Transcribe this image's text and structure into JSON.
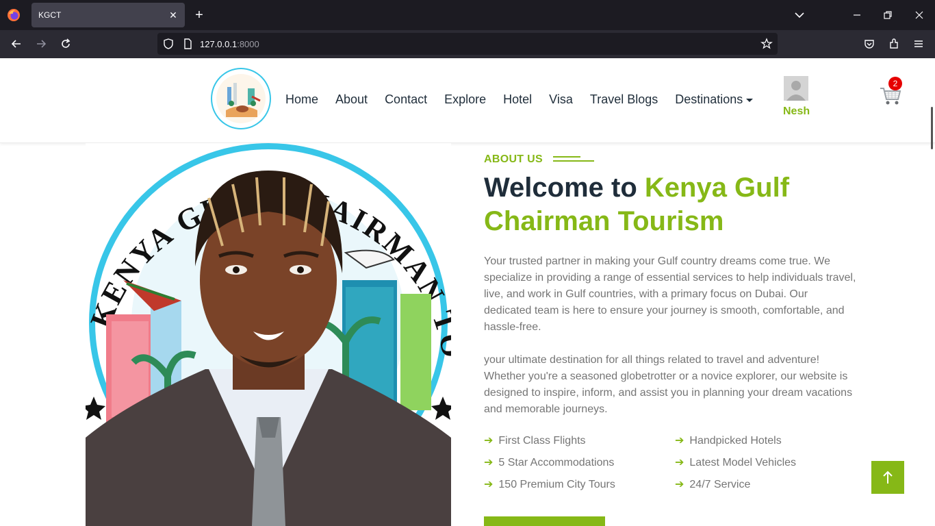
{
  "browser": {
    "tab_title": "KGCT",
    "tab_close": "✕",
    "new_tab": "+",
    "url_host": "127.0.0.1",
    "url_port": ":8000"
  },
  "header": {
    "menu": [
      {
        "label": "Home"
      },
      {
        "label": "About"
      },
      {
        "label": "Contact"
      },
      {
        "label": "Explore"
      },
      {
        "label": "Hotel"
      },
      {
        "label": "Visa"
      },
      {
        "label": "Travel Blogs"
      },
      {
        "label": "Destinations"
      }
    ],
    "user_name": "Nesh",
    "cart_count": "2"
  },
  "about": {
    "eyebrow": "ABOUT US",
    "title_lead": "Welcome to ",
    "title_accent": "Kenya Gulf Chairman Tourism",
    "paragraph1": "Your trusted partner in making your Gulf country dreams come true. We specialize in providing a range of essential services to help individuals travel, live, and work in Gulf countries, with a primary focus on Dubai. Our dedicated team is here to ensure your journey is smooth, comfortable, and hassle-free.",
    "paragraph2": "your ultimate destination for all things related to travel and adventure! Whether you're a seasoned globetrotter or a novice explorer, our website is designed to inspire, inform, and assist you in planning your dream vacations and memorable journeys.",
    "features": [
      "First Class Flights",
      "Handpicked Hotels",
      "5 Star Accommodations",
      "Latest Model Vehicles",
      "150 Premium City Tours",
      "24/7 Service"
    ],
    "image_logo_text": "KENYA GULF CHAIRMAN TOURISM"
  },
  "back_to_top_icon": "arrow-up-icon",
  "colors": {
    "accent": "#86b817",
    "heading": "#1f2d3a",
    "body_text": "#757575",
    "badge": "#e60000",
    "ring": "#38c6e8"
  }
}
